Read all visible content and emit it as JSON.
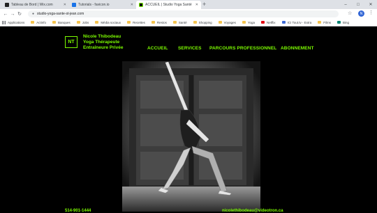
{
  "browser": {
    "tabs": [
      {
        "title": "Tableau de Bord | Wix.com",
        "favicon_color": "#222222",
        "active": false
      },
      {
        "title": "Tutorials - favicon.io",
        "favicon_color": "#1a73e8",
        "active": false
      },
      {
        "title": "ACCUEIL | Studio Yoga Santé",
        "favicon_color": "#7cfc00",
        "active": true
      }
    ],
    "new_tab": "+",
    "window_controls": {
      "minimize": "–",
      "maximize": "□",
      "close": "✕"
    },
    "address": "studio-yoga-sante-st-jean.com",
    "profile_initial": "N",
    "bookmarks": [
      {
        "label": "Applications",
        "type": "apps"
      },
      {
        "label": "Actinfo",
        "type": "folder"
      },
      {
        "label": "Banques",
        "type": "folder"
      },
      {
        "label": "Jobs",
        "type": "folder"
      },
      {
        "label": "Média sociaux",
        "type": "folder"
      },
      {
        "label": "Recettes",
        "type": "folder"
      },
      {
        "label": "Restos",
        "type": "folder"
      },
      {
        "label": "Santé",
        "type": "folder"
      },
      {
        "label": "Shopping",
        "type": "folder"
      },
      {
        "label": "Voyages",
        "type": "folder"
      },
      {
        "label": "Yoga",
        "type": "folder"
      },
      {
        "label": "Netflix",
        "type": "netflix"
      },
      {
        "label": "ICI Tout.tv - Extra",
        "type": "site"
      },
      {
        "label": "Films",
        "type": "folder"
      },
      {
        "label": "Bing",
        "type": "bing"
      }
    ]
  },
  "site": {
    "logo_text": "NT",
    "brand_lines": [
      "Nicole Thibodeau",
      "Yoga Thérapeute",
      "Entraîneure Privée"
    ],
    "menu": [
      {
        "label": "ACCUEIL"
      },
      {
        "label": "SERVICES"
      },
      {
        "label": "PARCOURS PROFESSIONNEL"
      },
      {
        "label": "ABONNEMENT"
      }
    ],
    "footer_phone": "514-901-1444",
    "footer_email": "nicolethibodeau@videotron.ca",
    "accent": "#7cfc00"
  }
}
